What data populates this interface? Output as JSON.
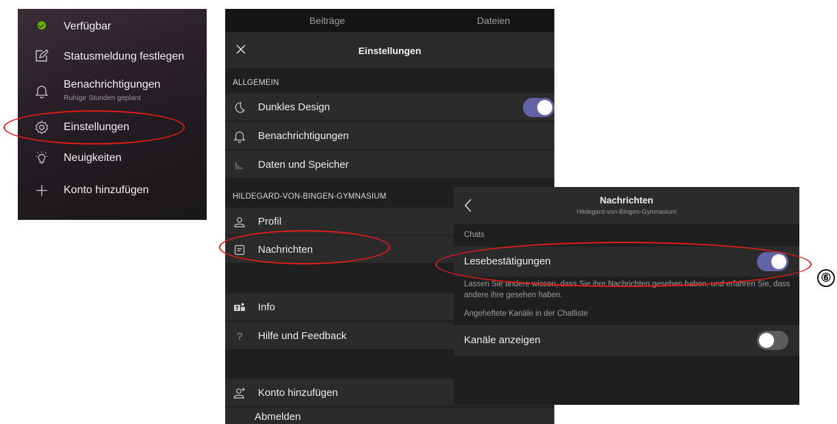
{
  "menu": {
    "items": [
      {
        "label": "Verfügbar",
        "icon": "status-available-icon"
      },
      {
        "label": "Statusmeldung festlegen",
        "icon": "edit-status-icon"
      },
      {
        "label": "Benachrichtigungen",
        "sublabel": "Ruhige Stunden geplant",
        "icon": "bell-icon"
      },
      {
        "label": "Einstellungen",
        "icon": "gear-icon"
      },
      {
        "label": "Neuigkeiten",
        "icon": "lightbulb-icon"
      },
      {
        "label": "Konto hinzufügen",
        "icon": "plus-icon"
      }
    ]
  },
  "settings": {
    "tabs": [
      "Beiträge",
      "Dateien"
    ],
    "title": "Einstellungen",
    "section_general": "ALLGEMEIN",
    "general_items": [
      {
        "label": "Dunkles Design",
        "icon": "moon-icon",
        "toggle": true
      },
      {
        "label": "Benachrichtigungen",
        "icon": "bell-icon"
      },
      {
        "label": "Daten und Speicher",
        "icon": "storage-icon"
      }
    ],
    "section_org": "HILDEGARD-VON-BINGEN-GYMNASIUM",
    "org_items": [
      {
        "label": "Profil",
        "icon": "person-icon"
      },
      {
        "label": "Nachrichten",
        "icon": "message-icon"
      }
    ],
    "info_items": [
      {
        "label": "Info",
        "icon": "teams-icon"
      },
      {
        "label": "Hilfe und Feedback",
        "icon": "help-icon"
      }
    ],
    "account_items": [
      {
        "label": "Konto hinzufügen",
        "icon": "add-person-icon"
      },
      {
        "label": "Abmelden",
        "icon": "signout-icon"
      }
    ]
  },
  "messages": {
    "title": "Nachrichten",
    "subtitle": "Hildegard-von-Bingen-Gymnasium",
    "section_chats": "Chats",
    "read_receipts_label": "Lesebestätigungen",
    "read_receipts_on": true,
    "read_receipts_desc": "Lassen Sie andere wissen, dass Sie ihre Nachrichten gesehen haben, und erfahren Sie, dass andere ihre gesehen haben.",
    "pinned_section": "Angeheftete Kanäle in der Chatliste",
    "show_channels_label": "Kanäle anzeigen",
    "show_channels_on": false
  },
  "annotation": {
    "marker": "⑥"
  },
  "colors": {
    "accent": "#6264a7",
    "highlight": "#e21b1b",
    "available": "#6bb700"
  }
}
